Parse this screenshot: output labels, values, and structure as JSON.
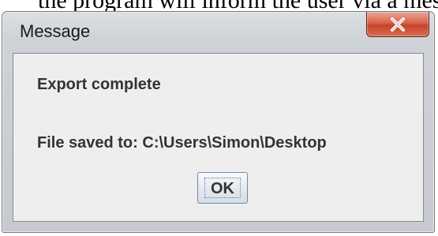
{
  "background_text": "the program will inform the user via a message",
  "dialog": {
    "title": "Message",
    "close_icon": "close-x-icon",
    "message_heading": "Export complete",
    "message_detail": "File saved to: C:\\Users\\Simon\\Desktop",
    "ok_label": "OK"
  },
  "colors": {
    "close_button": "#d0513a",
    "panel_background": "#eeeeee",
    "text": "#333333"
  }
}
